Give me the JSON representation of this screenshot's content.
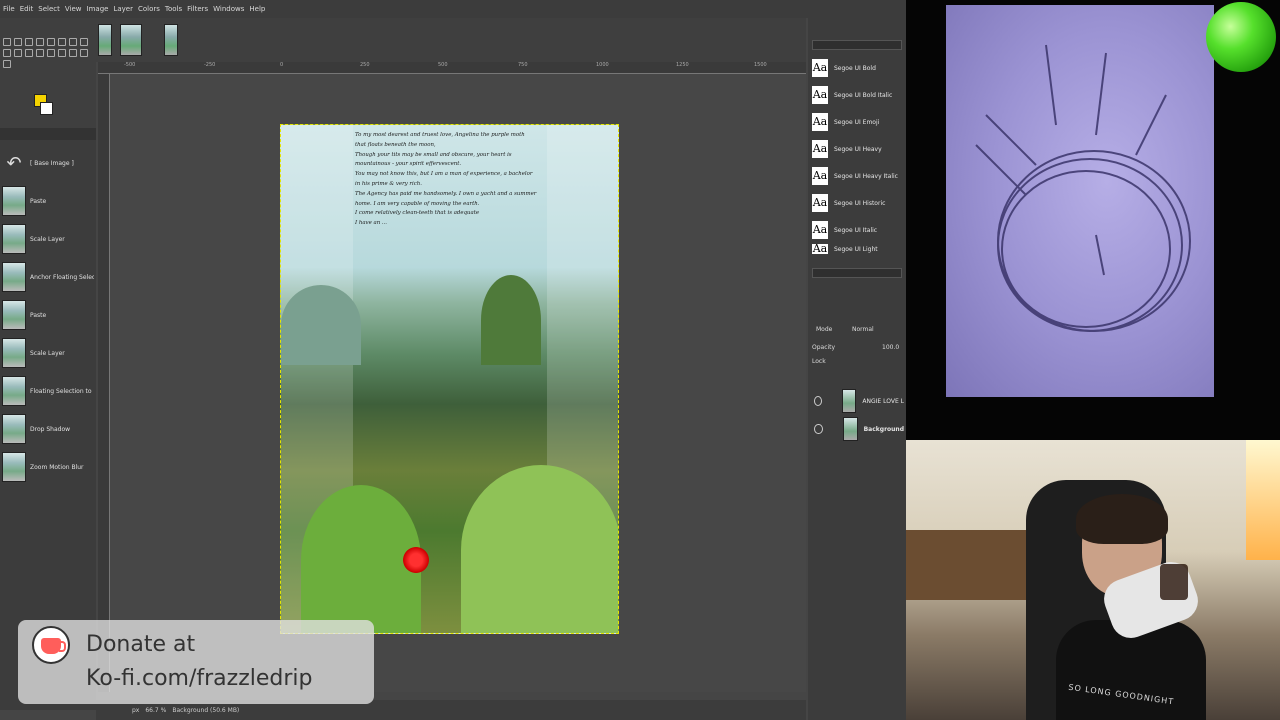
{
  "menubar": {
    "items": [
      "File",
      "Edit",
      "Select",
      "View",
      "Image",
      "Layer",
      "Colors",
      "Tools",
      "Filters",
      "Windows",
      "Help"
    ]
  },
  "history": {
    "items": [
      {
        "label": "[ Base Image ]",
        "icon": "undo-arrow-icon"
      },
      {
        "label": "Paste"
      },
      {
        "label": "Scale Layer"
      },
      {
        "label": "Anchor Floating Select"
      },
      {
        "label": "Paste"
      },
      {
        "label": "Scale Layer"
      },
      {
        "label": "Floating Selection to L"
      },
      {
        "label": "Drop Shadow"
      },
      {
        "label": "Zoom Motion Blur"
      }
    ]
  },
  "ruler": {
    "labels": [
      "-500",
      "-250",
      "0",
      "250",
      "500",
      "750",
      "1000",
      "1250",
      "1500"
    ]
  },
  "poem": {
    "lines": [
      "To my most dearest and truest love, Angelina the purple moth",
      "that floats beneath the moon,",
      "",
      "Though your tits may be small and obscure, your heart is",
      "mountainous - your spirit effervescent.",
      "You may not know this, but I am a man of experience, a bachelor",
      "in his prime & very rich.",
      "The Agency has paid me handsomely. I own a yacht and a summer",
      "home. I am very capable of moving the earth.",
      "I come relatively clean-teeth that is adequate",
      "",
      "I have an ..."
    ]
  },
  "statusbar": {
    "unit": "px",
    "zoom": "66.7 %",
    "layer_info": "Background (50.6 MB)"
  },
  "dock": {
    "fonts": [
      "Segoe UI Bold",
      "Segoe UI Bold Italic",
      "Segoe UI Emoji",
      "Segoe UI Heavy",
      "Segoe UI Heavy Italic",
      "Segoe UI Historic",
      "Segoe UI Italic",
      "Segoe UI Light"
    ],
    "mode_label": "Mode",
    "mode_value": "Normal",
    "opacity_label": "Opacity",
    "opacity_value": "100.0",
    "lock_label": "Lock",
    "layers": [
      {
        "name": "ANGIE LOVE L"
      },
      {
        "name": "Background"
      }
    ]
  },
  "donate": {
    "line1": "Donate at",
    "line2": "Ko-fi.com/frazzledrip"
  },
  "webcam": {
    "shirt_text": "SO LONG GOODNIGHT"
  }
}
